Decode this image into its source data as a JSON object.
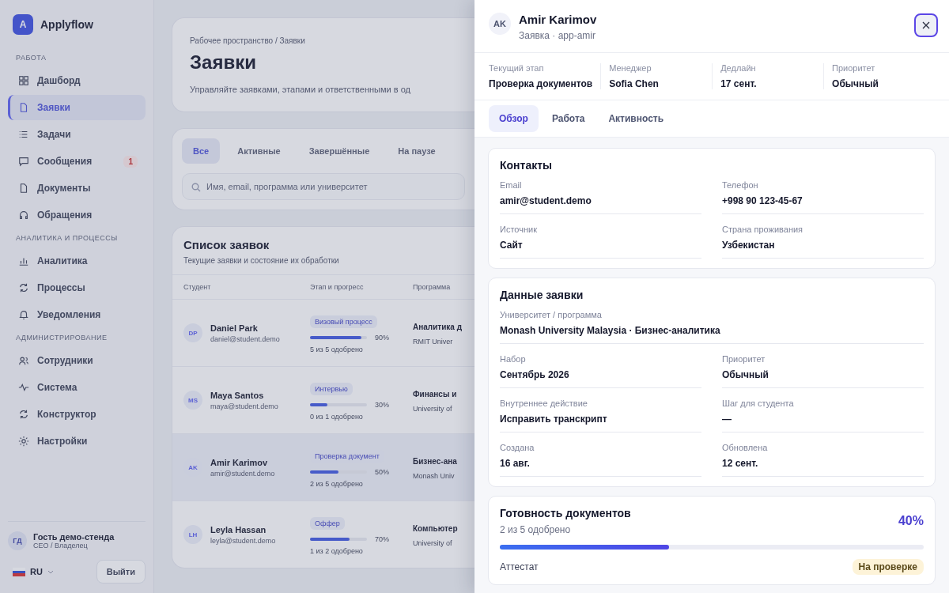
{
  "sidebar": {
    "logo": "A",
    "brand": "Applyflow",
    "sections": [
      {
        "title": "РАБОТА",
        "items": [
          {
            "label": "Дашборд",
            "selected": false
          },
          {
            "label": "Заявки",
            "selected": true
          },
          {
            "label": "Задачи",
            "selected": false
          },
          {
            "label": "Сообщения",
            "selected": false,
            "badge": "1"
          },
          {
            "label": "Документы",
            "selected": false
          },
          {
            "label": "Обращения",
            "selected": false
          }
        ]
      },
      {
        "title": "АНАЛИТИКА И ПРОЦЕССЫ",
        "items": [
          {
            "label": "Аналитика",
            "selected": false
          },
          {
            "label": "Процессы",
            "selected": false
          },
          {
            "label": "Уведомления",
            "selected": false
          }
        ]
      },
      {
        "title": "АДМИНИСТРИРОВАНИЕ",
        "items": [
          {
            "label": "Сотрудники",
            "selected": false
          },
          {
            "label": "Система",
            "selected": false
          },
          {
            "label": "Конструктор",
            "selected": false
          },
          {
            "label": "Настройки",
            "selected": false
          }
        ]
      }
    ],
    "user": {
      "initials": "ГД",
      "name": "Гость демо-стенда",
      "role": "CEO / Владелец"
    },
    "language": "RU",
    "logout": "Выйти"
  },
  "main": {
    "breadcrumb": "Рабочее пространство / Заявки",
    "title": "Заявки",
    "subtitle": "Управляйте заявками, этапами и ответственными в од",
    "filters": [
      {
        "label": "Все",
        "selected": true
      },
      {
        "label": "Активные",
        "selected": false
      },
      {
        "label": "Завершённые",
        "selected": false
      },
      {
        "label": "На паузе",
        "selected": false
      }
    ],
    "search": {
      "placeholder": "Имя, email, программа или университет"
    },
    "list": {
      "title": "Список заявок",
      "subtitle": "Текущие заявки и состояние их обработки",
      "columns": [
        "Студент",
        "Этап и прогресс",
        "Программа"
      ],
      "rows": [
        {
          "initials": "DP",
          "name": "Daniel Park",
          "email": "daniel@student.demo",
          "stage": "Визовый процесс",
          "level": 0.9,
          "percent": "90%",
          "approved": "5 из 5 одобрено",
          "program": "Аналитика д",
          "university": "RMIT Univer",
          "selected": false
        },
        {
          "initials": "MS",
          "name": "Maya Santos",
          "email": "maya@student.demo",
          "stage": "Интервью",
          "level": 0.3,
          "percent": "30%",
          "approved": "0 из 1 одобрено",
          "program": "Финансы и",
          "university": "University of",
          "selected": false
        },
        {
          "initials": "AK",
          "name": "Amir Karimov",
          "email": "amir@student.demo",
          "stage": "Проверка документ",
          "level": 0.5,
          "percent": "50%",
          "approved": "2 из 5 одобрено",
          "program": "Бизнес-ана",
          "university": "Monash Univ",
          "selected": true
        },
        {
          "initials": "LH",
          "name": "Leyla Hassan",
          "email": "leyla@student.demo",
          "stage": "Оффер",
          "level": 0.7,
          "percent": "70%",
          "approved": "1 из 2 одобрено",
          "program": "Компьютер",
          "university": "University of",
          "selected": false
        }
      ]
    }
  },
  "drawer": {
    "initials": "AK",
    "name": "Amir Karimov",
    "subtitle": "Заявка · app-amir",
    "meta": [
      {
        "label": "Текущий этап",
        "value": "Проверка документов"
      },
      {
        "label": "Менеджер",
        "value": "Sofia Chen"
      },
      {
        "label": "Дедлайн",
        "value": "17 сент."
      },
      {
        "label": "Приоритет",
        "value": "Обычный"
      }
    ],
    "tabs": [
      {
        "label": "Обзор",
        "selected": true
      },
      {
        "label": "Работа",
        "selected": false
      },
      {
        "label": "Активность",
        "selected": false
      }
    ],
    "sections": [
      {
        "title": "Контакты",
        "fields": [
          {
            "kind": "half",
            "label": "Email",
            "value": "amir@student.demo"
          },
          {
            "kind": "half",
            "label": "Телефон",
            "value": "+998 90 123-45-67"
          },
          {
            "kind": "half",
            "label": "Источник",
            "value": "Сайт"
          },
          {
            "kind": "half",
            "label": "Страна проживания",
            "value": "Узбекистан"
          }
        ]
      },
      {
        "title": "Данные заявки",
        "fields": [
          {
            "kind": "wide",
            "label": "Университет / программа",
            "value": "Monash University Malaysia · Бизнес-аналитика"
          },
          {
            "kind": "half",
            "label": "Набор",
            "value": "Сентябрь 2026"
          },
          {
            "kind": "half",
            "label": "Приоритет",
            "value": "Обычный"
          },
          {
            "kind": "half",
            "label": "Внутреннее действие",
            "value": "Исправить транскрипт"
          },
          {
            "kind": "half",
            "label": "Шаг для студента",
            "value": "—"
          },
          {
            "kind": "half",
            "label": "Создана",
            "value": "16 авг."
          },
          {
            "kind": "half",
            "label": "Обновлена",
            "value": "12 сент."
          }
        ]
      }
    ],
    "readiness": {
      "title": "Готовность документов",
      "subtitle": "2 из 5 одобрено",
      "percent": "40%",
      "level": 0.4,
      "documents": [
        {
          "name": "Аттестат",
          "status": "На проверке"
        }
      ]
    }
  }
}
